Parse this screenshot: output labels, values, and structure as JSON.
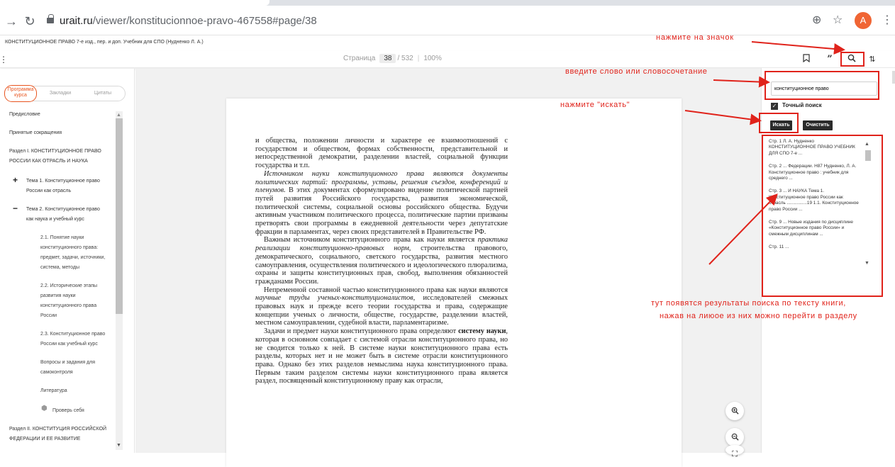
{
  "browser": {
    "url_host": "urait.ru",
    "url_path": "/viewer/konstitucionnoe-pravo-467558#page/38",
    "avatar_letter": "A",
    "icons": [
      "back-arrow-icon",
      "reload-icon",
      "lock-icon",
      "zoom-icon",
      "star-icon",
      "more-menu-icon"
    ]
  },
  "book": {
    "title": "КОНСТИТУЦИОННОЕ ПРАВО 7-е изд., пер. и доп. Учебник для СПО (Нудненко Л. А.)"
  },
  "toolbar": {
    "page_label": "Страница",
    "page_current": "38",
    "page_total": "/ 532",
    "zoom": "100%",
    "icons": [
      "bookmark-icon",
      "quote-icon",
      "search-icon",
      "sort-icon"
    ]
  },
  "sidebar": {
    "tabs": [
      "Программа курса",
      "Закладки",
      "Цитаты"
    ],
    "items": [
      "Предисловие",
      "Принятые сокращения",
      "Раздел I. КОНСТИТУЦИОННОЕ ПРАВО",
      "РОССИИ КАК ОТРАСЛЬ И НАУКА",
      "Тема 1. Конституционное право",
      "России как отрасль",
      "Тема 2. Конституционное право",
      "как наука и учебный курс",
      "2.1. Понятие науки",
      "конституционного права:",
      "предмет, задачи, источники,",
      "система, методы",
      "2.2. Исторические этапы",
      "развития науки",
      "конституционного права",
      "России",
      "2.3. Конституционное право",
      "России как учебный курс",
      "Вопросы и задания для",
      "самоконтроля",
      "Литература",
      "Проверь себя",
      "Раздел II. КОНСТИТУЦИЯ РОССИЙСКОЙ",
      "ФЕДЕРАЦИИ И ЕЕ РАЗВИТИЕ"
    ]
  },
  "page_text": {
    "p1": "и общества, положении личности и характере ее взаимоотношений с государством и обществом, формах собственности, представительной и непосредственной демократии, разделении властей, социальной функции государства и т.п.",
    "p2_italic": "Источником науки конституционного права являются документы политических партий: программы, уставы, решения съездов, конференций и пленумов.",
    "p2_rest": " В этих документах сформулировано видение политической партией путей развития Российского государства, развития экономической, политической системы, социальной основы российского общества. Будучи активным участником политического процесса, политические партии призваны претворять свои программы в ежедневной деятельности через депутатские фракции в парламентах, через своих представителей в Правительстве РФ.",
    "p3_a": "Важным источником конституционного права как науки является ",
    "p3_italic": "практика реализации конституционно-правовых норм",
    "p3_b": ", строительства правового, демократического, социального, светского государства, развития местного самоуправления, осуществления политического и идеологического плюрализма, охраны и защиты конституционных прав, свобод, выполнения обязанностей гражданами России.",
    "p4_a": "Непременной составной частью конституционного права как науки являются ",
    "p4_italic": "научные труды ученых-конституционалистов",
    "p4_b": ", исследователей смежных правовых наук и прежде всего теории государства и права, содержащие концепции ученых о личности, обществе, государстве, разделении властей, местном самоуправлении, судебной власти, парламентаризме.",
    "p5_a": "Задачи и предмет науки конституционного права определяют ",
    "p5_bold": "систему науки",
    "p5_b": ", которая в основном совпадает с системой отрасли конституционного права, но не сводится только к ней. В системе науки конституционного права есть разделы, которых нет и не может быть в системе отрасли конституционного права. Однако без этих разделов немыслима наука конституционного права. Первым таким разделом системы науки конституционного права является раздел, посвященный конституционному праву как отрасли,"
  },
  "search_panel": {
    "input_value": "конституционное право",
    "exact_label": "Точный поиск",
    "search_button": "Искать",
    "clear_button": "Очистить",
    "results": [
      "Стр. 1 Л. А. Нудненко КОНСТИТУЦИОННОЕ ПРАВО УЧЕБНИК ДЛЯ СПО 7-е ...",
      "Стр. 2 ... Федерации. Н87 Нудненко, Л. А. Конституционное право : учебник для среднего ...",
      "Стр. 3 ... И НАУКА Тема 1. Конституционное право России как отрасль ................19 1.1. Конституционное право России ...",
      "Стр. 9 ... Новые издания по дисциплине «Конституционное право России» и смежным дисциплинам ...",
      "Стр. 11 ..."
    ]
  },
  "annotations": {
    "click_icon": "нажмите на значок",
    "enter_word": "введите слово или словосочетание",
    "press_search": "нажмите \"искать\"",
    "results_line1": "тут появятся результаты поиска по тексту книги,",
    "results_line2": "нажав на лиюое из них можно перейти в разделу",
    "color": "#e0231b"
  }
}
